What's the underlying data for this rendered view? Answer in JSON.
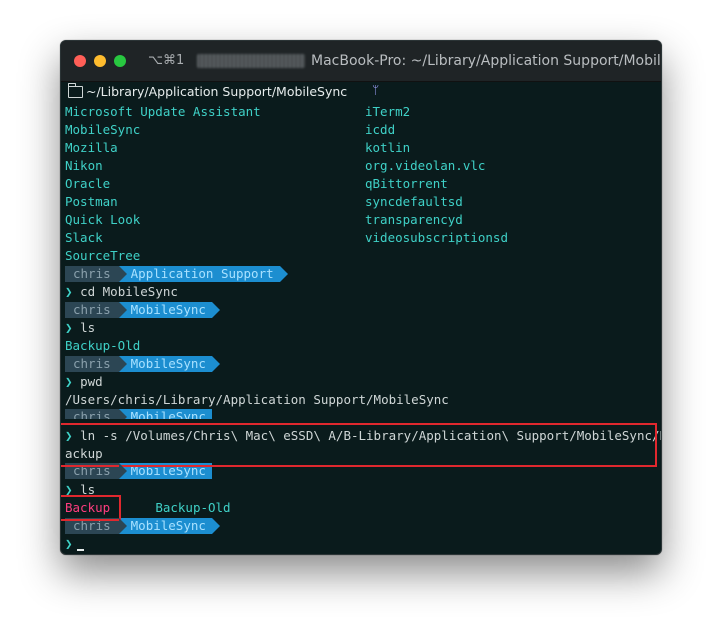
{
  "window": {
    "shortcut": "⌥⌘1",
    "title": "MacBook-Pro: ~/Library/Application Support/MobileS..."
  },
  "pathbar": {
    "path": "~/Library/Application Support/MobileSync",
    "icon": "folder-icon",
    "branch_icon": "git-branch-icon"
  },
  "listing": {
    "col1": [
      "Microsoft Update Assistant",
      "MobileSync",
      "Mozilla",
      "Nikon",
      "Oracle",
      "Postman",
      "Quick Look",
      "Slack",
      "SourceTree"
    ],
    "col2": [
      "iTerm2",
      "icdd",
      "kotlin",
      "org.videolan.vlc",
      "qBittorrent",
      "syncdefaultsd",
      "transparencyd",
      "videosubscriptionsd"
    ]
  },
  "prompts": [
    {
      "user": "chris",
      "dir": "Application Support"
    },
    {
      "user": "chris",
      "dir": "MobileSync"
    },
    {
      "user": "chris",
      "dir": "MobileSync"
    },
    {
      "user": "chris",
      "dir": "MobileSync"
    },
    {
      "user": "chris",
      "dir": "MobileSync"
    },
    {
      "user": "chris",
      "dir": "MobileSync"
    }
  ],
  "commands": {
    "c1": "cd MobileSync",
    "c2": "ls",
    "c3": "pwd",
    "c4_line1": "ln -s /Volumes/Chris\\ Mac\\ eSSD\\ A/B-Library/Application\\ Support/MobileSync/B",
    "c4_line2": "ackup",
    "c5": "ls"
  },
  "outputs": {
    "o1": "Backup-Old",
    "o2": "/Users/chris/Library/Application Support/MobileSync",
    "o3_a": "Backup",
    "o3_b": "Backup-Old"
  },
  "prompt_symbol": "❯",
  "colors": {
    "bg": "#0a1b1c",
    "cyan": "#3fd1c7",
    "user_segment": "#2c4654",
    "dir_segment": "#1c8ed0",
    "highlight": "#e0282e",
    "symlink": "#ff3d7f"
  }
}
